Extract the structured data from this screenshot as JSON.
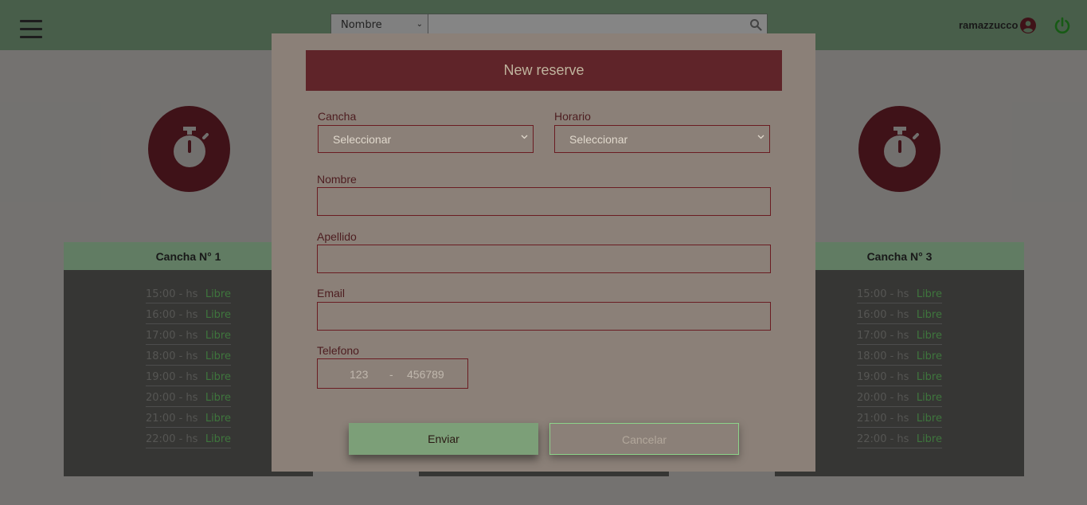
{
  "header": {
    "search_field_option": "Nombre",
    "search_value": "",
    "username": "ramazzucco"
  },
  "courts": [
    {
      "title": "Cancha N° 1",
      "slots": [
        {
          "time": "15:00 - hs",
          "state": "Libre"
        },
        {
          "time": "16:00 - hs",
          "state": "Libre"
        },
        {
          "time": "17:00 - hs",
          "state": "Libre"
        },
        {
          "time": "18:00 - hs",
          "state": "Libre"
        },
        {
          "time": "19:00 - hs",
          "state": "Libre"
        },
        {
          "time": "20:00 - hs",
          "state": "Libre"
        },
        {
          "time": "21:00 - hs",
          "state": "Libre"
        },
        {
          "time": "22:00 - hs",
          "state": "Libre"
        }
      ]
    },
    {
      "title": "Cancha N° 3",
      "slots": [
        {
          "time": "15:00 - hs",
          "state": "Libre"
        },
        {
          "time": "16:00 - hs",
          "state": "Libre"
        },
        {
          "time": "17:00 - hs",
          "state": "Libre"
        },
        {
          "time": "18:00 - hs",
          "state": "Libre"
        },
        {
          "time": "19:00 - hs",
          "state": "Libre"
        },
        {
          "time": "20:00 - hs",
          "state": "Libre"
        },
        {
          "time": "21:00 - hs",
          "state": "Libre"
        },
        {
          "time": "22:00 - hs",
          "state": "Libre"
        }
      ]
    }
  ],
  "modal": {
    "title": "New reserve",
    "cancha_label": "Cancha",
    "cancha_value": "Seleccionar",
    "horario_label": "Horario",
    "horario_value": "Seleccionar",
    "nombre_label": "Nombre",
    "nombre_value": "",
    "apellido_label": "Apellido",
    "apellido_value": "",
    "email_label": "Email",
    "email_value": "",
    "telefono_label": "Telefono",
    "phone_area_placeholder": "123",
    "phone_separator": "-",
    "phone_number_placeholder": "456789",
    "submit_label": "Enviar",
    "cancel_label": "Cancelar"
  },
  "colors": {
    "header_green": "#80ac84",
    "modal_header": "#5f2429",
    "free_slot": "#6ddb6a",
    "timer_circle": "#6e1520"
  }
}
